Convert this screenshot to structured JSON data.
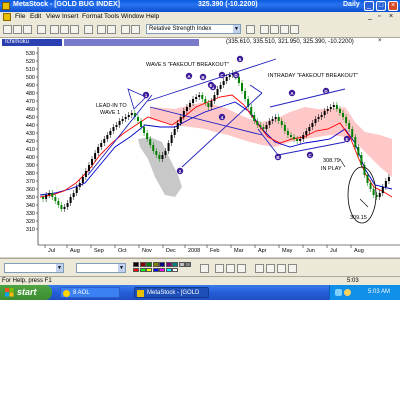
{
  "app": {
    "title": "MetaStock - [GOLD BUG INDEX]",
    "price": "325.390 (-10.2200)",
    "period": "Daily"
  },
  "menu": [
    "File",
    "Edit",
    "View",
    "Insert",
    "Format",
    "Tools",
    "Window",
    "Help"
  ],
  "toolbar": {
    "indicator_select": "Relative Strength Index"
  },
  "info": {
    "symbol": "Ichimoku",
    "values": "(335.610, 335.510, 321.950, 325.390, -10.2200)"
  },
  "chart": {
    "y_ticks": [
      "530",
      "520",
      "510",
      "500",
      "490",
      "480",
      "470",
      "460",
      "450",
      "440",
      "430",
      "420",
      "410",
      "400",
      "390",
      "380",
      "370",
      "360",
      "350",
      "340",
      "330",
      "320",
      "310"
    ],
    "x_labels": [
      "Jul",
      "Aug",
      "Sep",
      "Oct",
      "Nov",
      "Dec",
      "2008",
      "Feb",
      "Mar",
      "Apr",
      "May",
      "Jun",
      "Jul",
      "Aug"
    ],
    "annotations": {
      "wave5": "WAVE 5 \"FAKEOUT BREAKOUT\"",
      "intraday": "INTRADAY \"FAKEOUT BREAKOUT\"",
      "leadin_1": "LEAD-IN TO",
      "leadin_2": "WAVE 1",
      "inplay_1": "308.79",
      "inplay_2": "IN PLAY",
      "low": "309.15"
    },
    "wave_labels": {
      "w1": "1",
      "w2": "2",
      "w3": "3",
      "w4": "4",
      "w5": "5",
      "a": "A",
      "b": "B",
      "c": "C",
      "d": "D",
      "e": "E",
      "a2": "A",
      "b2": "B",
      "c2": "C",
      "d2": "D",
      "e2": "E"
    },
    "colors": {
      "up_candle": "#000000",
      "down_candle": "#008000",
      "tenkan": "#ff0000",
      "kijun": "#0000cc",
      "cloud": "#ffc8c8",
      "cloud_gray": "#c8c8c8",
      "trend_lines": "#2020c0",
      "wave_marker": "#3b1a9a"
    }
  },
  "status": {
    "help": "For Help, press F1",
    "time": "5:03"
  },
  "taskbar": {
    "start": "start",
    "task1": "8 AOL",
    "task2": "MetaStock - [GOLD B...",
    "clock": "5:03 AM"
  }
}
